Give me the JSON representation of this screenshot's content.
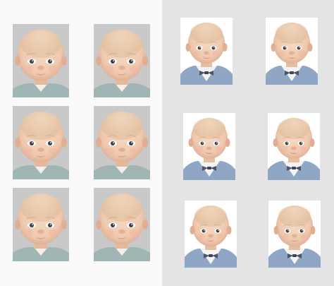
{
  "sheets": [
    {
      "name": "sheet-grey-background",
      "background_color": "#c9c9c9",
      "clothing_color": "#9fb6b4",
      "photo_count": 6,
      "columns": 2,
      "rows": 3,
      "subject": "baby-face"
    },
    {
      "name": "sheet-white-background",
      "background_color": "#ffffff",
      "clothing_color": "#8fa6c4",
      "accessory": "bow-tie",
      "photo_count": 6,
      "columns": 2,
      "rows": 3,
      "subject": "baby-face"
    }
  ],
  "colors": {
    "page_left": "#fafafa",
    "page_right": "#e4e4e4",
    "skin": "#efcdb2",
    "skin_shadow": "#d9a98c",
    "hair": "#e8d3b2",
    "eye": "#3b3f4a",
    "lip": "#d58e86"
  }
}
